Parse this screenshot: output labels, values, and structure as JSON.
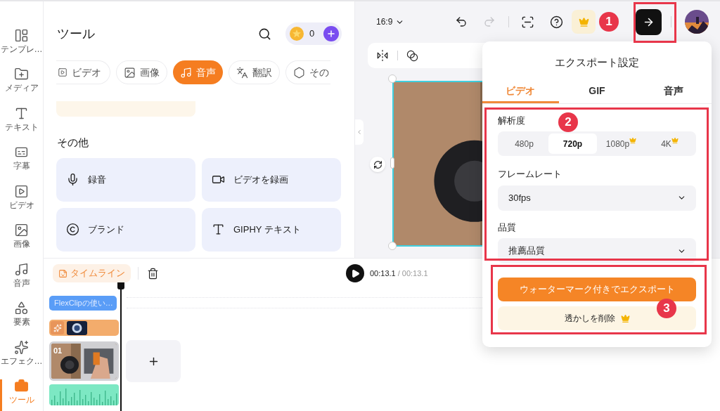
{
  "sidebar": {
    "items": [
      {
        "label": "テンプレ…",
        "selected": false
      },
      {
        "label": "メディア",
        "selected": false
      },
      {
        "label": "テキスト",
        "selected": false
      },
      {
        "label": "字幕",
        "selected": false
      },
      {
        "label": "ビデオ",
        "selected": false
      },
      {
        "label": "画像",
        "selected": false
      },
      {
        "label": "音声",
        "selected": false
      },
      {
        "label": "要素",
        "selected": false
      },
      {
        "label": "エフェク…",
        "selected": false
      },
      {
        "label": "ツール",
        "selected": true
      }
    ]
  },
  "tools_panel": {
    "title": "ツール",
    "coins": "0",
    "categories": [
      {
        "label": "ビデオ",
        "selected": false
      },
      {
        "label": "画像",
        "selected": false
      },
      {
        "label": "音声",
        "selected": true
      },
      {
        "label": "翻訳",
        "selected": false
      },
      {
        "label": "その",
        "selected": false
      }
    ],
    "section_title": "その他",
    "tools": [
      {
        "label": "録音"
      },
      {
        "label": "ビデオを録画"
      },
      {
        "label": "ブランド"
      },
      {
        "label": "GIPHY テキスト"
      }
    ]
  },
  "canvas_toolbar": {
    "aspect_ratio": "16:9"
  },
  "timeline": {
    "label": "タイムライン",
    "current_time": "00:13.1",
    "total_time": "/ 00:13.1",
    "text_clip": "FlexClipの使い…",
    "video_clip_number": "01"
  },
  "export_panel": {
    "title": "エクスポート設定",
    "tabs": [
      {
        "label": "ビデオ",
        "selected": true
      },
      {
        "label": "GIF",
        "selected": false
      },
      {
        "label": "音声",
        "selected": false
      }
    ],
    "resolution_label": "解析度",
    "resolutions": [
      {
        "label": "480p",
        "selected": false,
        "premium": false
      },
      {
        "label": "720p",
        "selected": true,
        "premium": false
      },
      {
        "label": "1080p",
        "selected": false,
        "premium": true
      },
      {
        "label": "4K",
        "selected": false,
        "premium": true
      }
    ],
    "frame_rate_label": "フレームレート",
    "frame_rate": "30fps",
    "quality_label": "品質",
    "quality": "推薦品質",
    "export_button": "ウォーターマーク付きでエクスポート",
    "remove_watermark_button": "透かしを削除"
  },
  "annotations": [
    {
      "number": "1"
    },
    {
      "number": "2"
    },
    {
      "number": "3"
    }
  ]
}
